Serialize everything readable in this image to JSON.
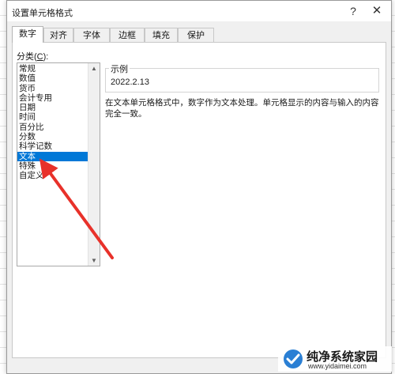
{
  "window": {
    "title": "设置单元格格式",
    "help_glyph": "?",
    "close_glyph": "✕"
  },
  "tabs": [
    {
      "label": "数字",
      "active": true
    },
    {
      "label": "对齐",
      "active": false
    },
    {
      "label": "字体",
      "active": false
    },
    {
      "label": "边框",
      "active": false
    },
    {
      "label": "填充",
      "active": false
    },
    {
      "label": "保护",
      "active": false
    }
  ],
  "category": {
    "label_prefix": "分类(",
    "label_accel": "C",
    "label_suffix": "):",
    "items": [
      "常规",
      "数值",
      "货币",
      "会计专用",
      "日期",
      "时间",
      "百分比",
      "分数",
      "科学记数",
      "文本",
      "特殊",
      "自定义"
    ],
    "selected": "文本"
  },
  "sample": {
    "legend": "示例",
    "value": "2022.2.13"
  },
  "description": "在文本单元格格式中，数字作为文本处理。单元格显示的内容与输入的内容完全一致。",
  "watermark": {
    "name": "纯净系统家园",
    "url": "www.yidaimei.com"
  },
  "colors": {
    "selection": "#0078d7",
    "annotation_arrow": "#e8312a",
    "watermark_blue": "#2a7fd4"
  }
}
